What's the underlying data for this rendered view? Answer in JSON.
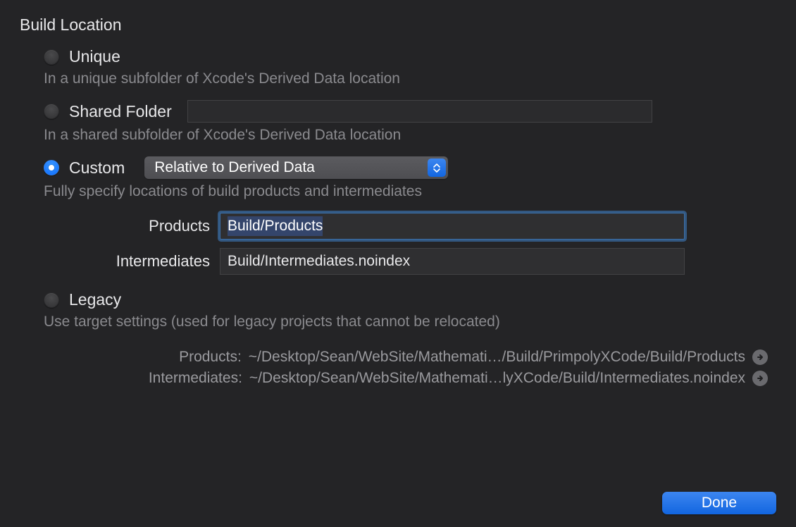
{
  "section_title": "Build Location",
  "options": {
    "unique": {
      "label": "Unique",
      "desc": "In a unique subfolder of Xcode's Derived Data location",
      "selected": false
    },
    "shared": {
      "label": "Shared Folder",
      "desc": "In a shared subfolder of Xcode's Derived Data location",
      "selected": false,
      "value": ""
    },
    "custom": {
      "label": "Custom",
      "desc": "Fully specify locations of build products and intermediates",
      "selected": true,
      "select_value": "Relative to Derived Data"
    },
    "legacy": {
      "label": "Legacy",
      "desc": "Use target settings (used for legacy projects that cannot be relocated)",
      "selected": false
    }
  },
  "fields": {
    "products": {
      "label": "Products",
      "value": "Build/Products",
      "focused": true,
      "selected_text": true
    },
    "intermediates": {
      "label": "Intermediates",
      "value": "Build/Intermediates.noindex",
      "focused": false
    }
  },
  "paths": {
    "products": {
      "label": "Products:",
      "value": "~/Desktop/Sean/WebSite/Mathemati…/Build/PrimpolyXCode/Build/Products"
    },
    "intermediates": {
      "label": "Intermediates:",
      "value": "~/Desktop/Sean/WebSite/Mathemati…lyXCode/Build/Intermediates.noindex"
    }
  },
  "footer": {
    "done_label": "Done"
  }
}
